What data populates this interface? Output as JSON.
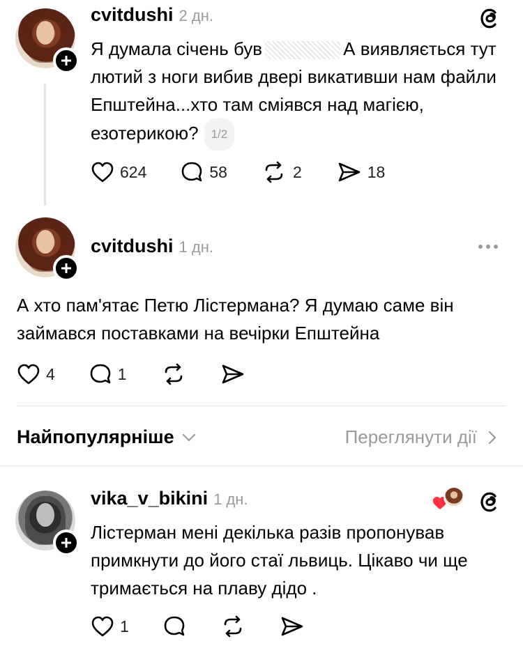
{
  "posts": [
    {
      "username": "cvitdushi",
      "time": "2 дн.",
      "text_before": "Я думала січень був",
      "text_after": "А виявляється тут лютий з ноги вибив двері викативши нам файли Епштейна...хто там сміявся над магією, езотерикою?",
      "page_indicator": "1/2",
      "likes": "624",
      "replies": "58",
      "reposts": "2",
      "shares": "18"
    },
    {
      "username": "cvitdushi",
      "time": "1 дн.",
      "text": "А хто пам'ятає Петю Лістермана? Я думаю саме він займався поставками на вечірки Епштейна",
      "likes": "4",
      "replies": "1"
    }
  ],
  "sort": {
    "label": "Найпопулярніше",
    "view_activity": "Переглянути дії"
  },
  "reply": {
    "username": "vika_v_bikini",
    "time": "1 дн.",
    "text": "Лістерман мені декілька разів пропонував примкнути до його стаї львиць. Цікаво чи ще тримається на плаву дідо .",
    "likes": "1"
  },
  "icons": {
    "threads": "threads-logo-icon",
    "like": "heart-icon",
    "reply": "comment-icon",
    "repost": "repost-icon",
    "share": "send-icon",
    "more": "more-dots-icon",
    "chevron": "chevron-icon"
  },
  "colors": {
    "text": "#000000",
    "muted": "#9a9a9a",
    "divider": "#e6e6e6",
    "liked_heart": "#ff3040"
  }
}
